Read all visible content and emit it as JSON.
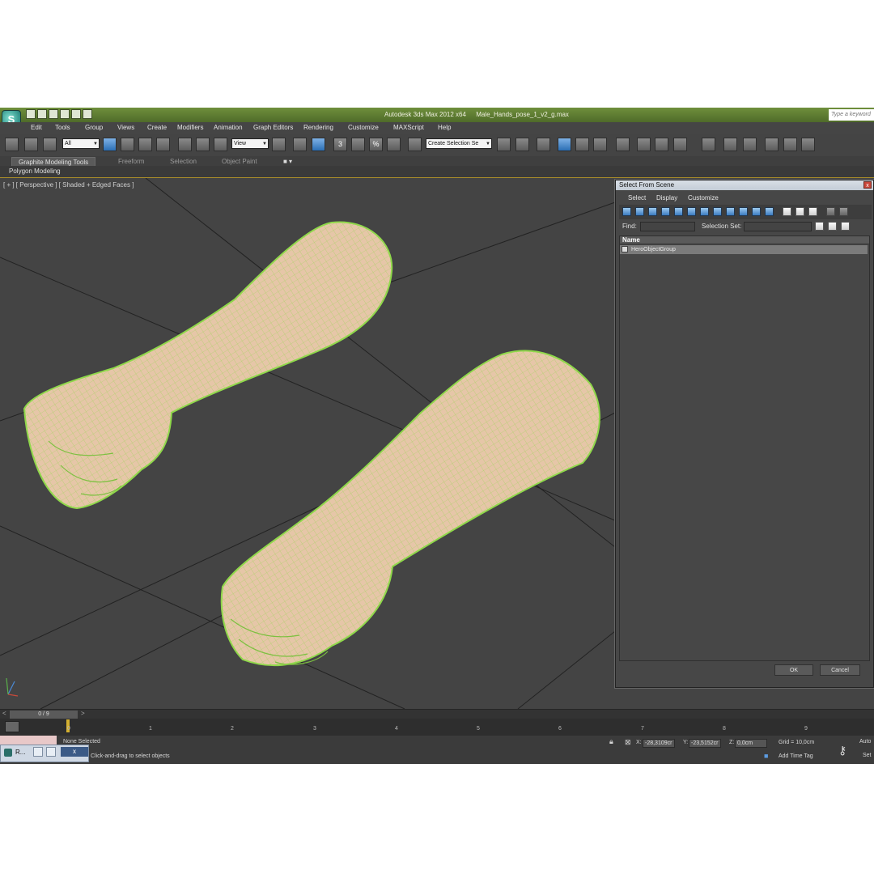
{
  "window": {
    "app_name": "Autodesk 3ds Max  2012 x64",
    "file_name": "Male_Hands_pose_1_v2_g.max",
    "search_placeholder": "Type a keyword"
  },
  "menu": [
    "Edit",
    "Tools",
    "Group",
    "Views",
    "Create",
    "Modifiers",
    "Animation",
    "Graph Editors",
    "Rendering",
    "Customize",
    "MAXScript",
    "Help"
  ],
  "toolbar": {
    "filter_value": "All",
    "reference_coord_value": "View",
    "selection_set_value": "Create Selection Se",
    "snap_labels": [
      "3",
      "%"
    ]
  },
  "ribbon": {
    "tabs": [
      "Graphite Modeling Tools",
      "Freeform",
      "Selection",
      "Object Paint"
    ],
    "panel_label": "Polygon Modeling"
  },
  "viewport": {
    "label": "[ + ] [ Perspective ] [ Shaded + Edged Faces ]",
    "colors": {
      "background": "#444444",
      "skin": "#e6c6a8",
      "wire": "#8fd84a",
      "grid": "#222222"
    }
  },
  "dialog": {
    "title": "Select From Scene",
    "close_label": "x",
    "menu": [
      "Select",
      "Display",
      "Customize"
    ],
    "find_label": "Find:",
    "find_value": "",
    "selection_set_label": "Selection Set:",
    "column_header": "Name",
    "items": [
      "HeroObjectGroup"
    ],
    "ok_label": "OK",
    "cancel_label": "Cancel"
  },
  "time": {
    "slider_label": "0 / 9",
    "ticks": [
      "0",
      "1",
      "2",
      "3",
      "4",
      "5",
      "6",
      "7",
      "8",
      "9"
    ]
  },
  "status": {
    "selection": "None Selected",
    "prompt": "Click-and-drag to select objects",
    "x_label": "X:",
    "x_value": "-28,3109cr",
    "y_label": "Y:",
    "y_value": "-23,5152cr",
    "z_label": "Z:",
    "z_value": "0,0cm",
    "grid": "Grid = 10,0cm",
    "add_time_tag": "Add Time Tag",
    "auto_key": "Auto",
    "set_key": "Set"
  },
  "taskbar": {
    "label": "R...",
    "close_label": "x"
  }
}
